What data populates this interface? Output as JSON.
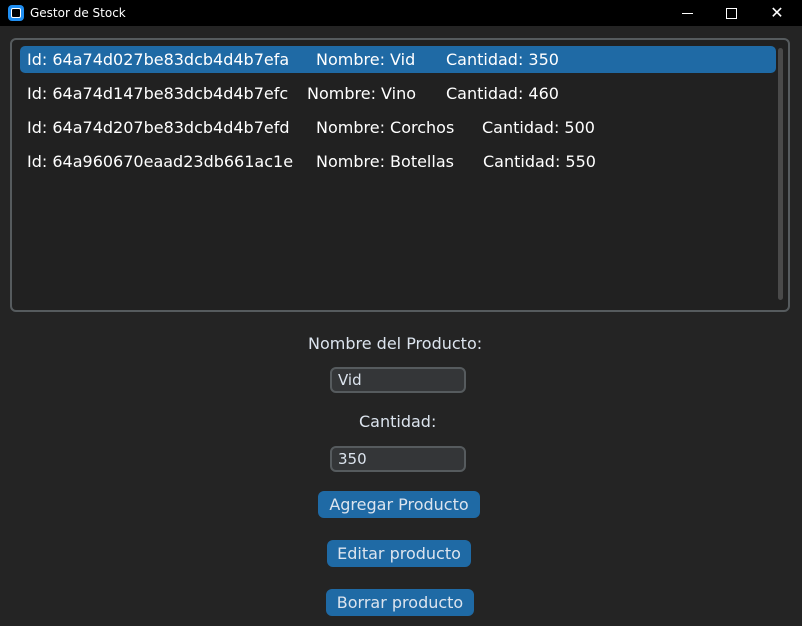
{
  "window": {
    "title": "Gestor de Stock",
    "icons": [
      "app-icon",
      "minimize-icon",
      "maximize-icon",
      "close-icon"
    ]
  },
  "products": [
    {
      "id": "Id: 64a74d027be83dcb4d4b7efa",
      "name": "Nombre: Vid",
      "qty": "Cantidad: 350",
      "selected": true
    },
    {
      "id": "Id: 64a74d147be83dcb4d4b7efc",
      "name": "Nombre: Vino",
      "qty": "Cantidad: 460",
      "selected": false
    },
    {
      "id": "Id: 64a74d207be83dcb4d4b7efd",
      "name": "Nombre: Corchos",
      "qty": "Cantidad: 500",
      "selected": false
    },
    {
      "id": "Id: 64a960670eaad23db661ac1e",
      "name": "Nombre: Botellas",
      "qty": "Cantidad: 550",
      "selected": false
    }
  ],
  "form": {
    "name_label": "Nombre del Producto:",
    "name_value": "Vid",
    "qty_label": "Cantidad:",
    "qty_value": "350"
  },
  "buttons": {
    "add": "Agregar Producto",
    "edit": "Editar producto",
    "delete": "Borrar producto"
  },
  "colors": {
    "accent": "#1f6aa5",
    "background": "#242424",
    "titlebar": "#000000"
  }
}
